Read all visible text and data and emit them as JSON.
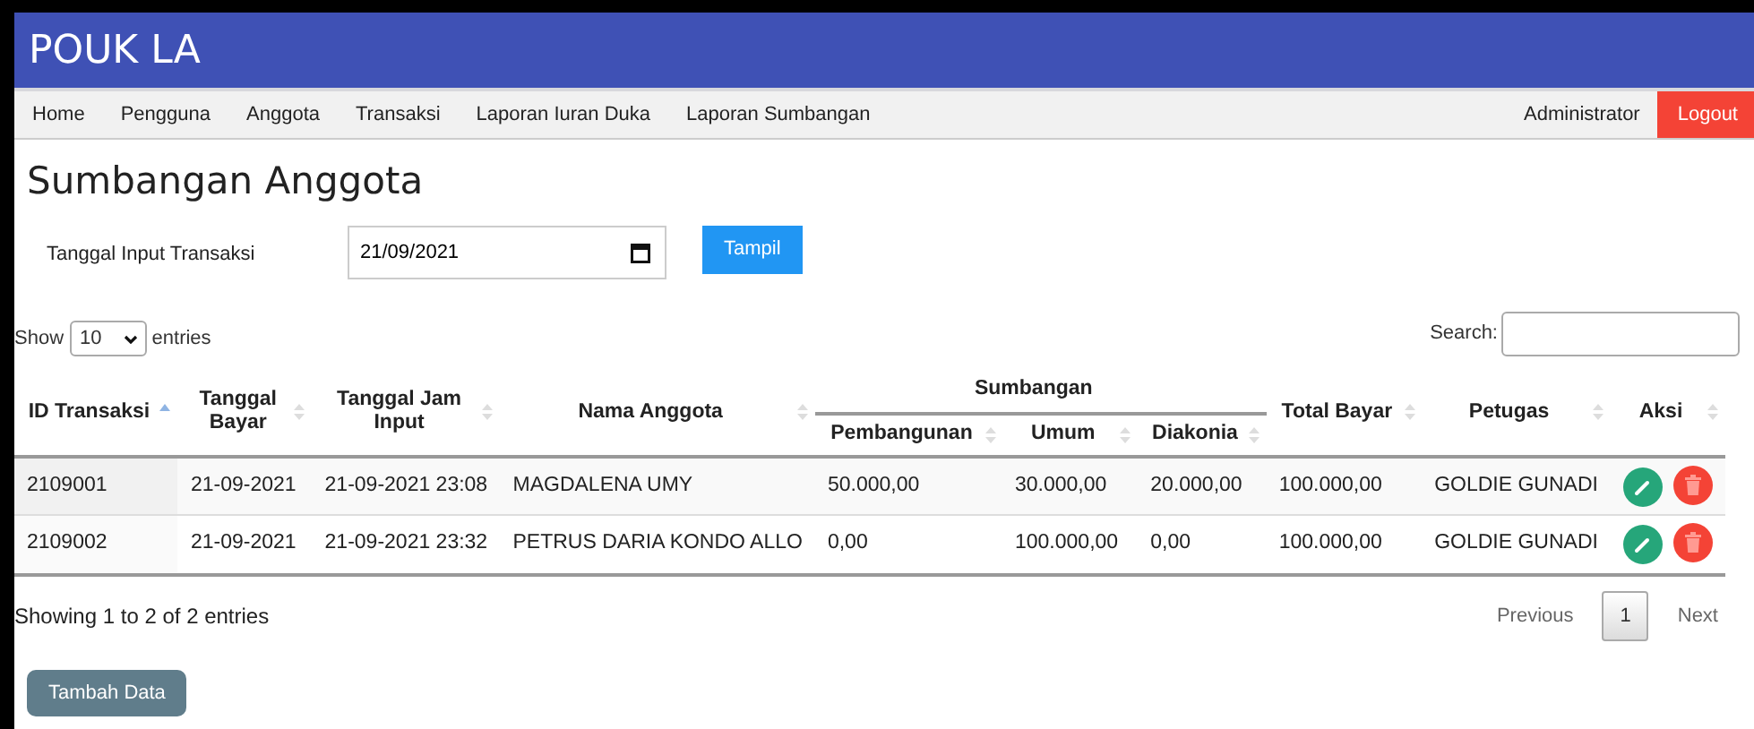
{
  "app_title": "POUK LA",
  "nav": {
    "items": [
      {
        "label": "Home"
      },
      {
        "label": "Pengguna"
      },
      {
        "label": "Anggota"
      },
      {
        "label": "Transaksi"
      },
      {
        "label": "Laporan Iuran Duka"
      },
      {
        "label": "Laporan Sumbangan"
      }
    ],
    "user": "Administrator",
    "logout": "Logout"
  },
  "page_title": "Sumbangan Anggota",
  "filter": {
    "label": "Tanggal Input Transaksi",
    "date_value": "21/09/2021",
    "button": "Tampil"
  },
  "table": {
    "length": {
      "prefix": "Show",
      "value": "10",
      "suffix": "entries"
    },
    "search_label": "Search:",
    "columns": [
      {
        "label": "ID Transaksi",
        "sorted": true
      },
      {
        "label": "Tanggal Bayar",
        "sorted": false
      },
      {
        "label": "Tanggal Jam Input",
        "sorted": false
      },
      {
        "label": "Nama Anggota",
        "sorted": false
      },
      {
        "label": "Sumbangan",
        "colspan": 3,
        "children": [
          {
            "label": "Pembangunan",
            "sorted": false
          },
          {
            "label": "Umum",
            "sorted": false
          },
          {
            "label": "Diakonia",
            "sorted": false
          }
        ]
      },
      {
        "label": "Total Bayar",
        "sorted": false
      },
      {
        "label": "Petugas",
        "sorted": false
      },
      {
        "label": "Aksi",
        "sorted": false
      }
    ],
    "rows": [
      {
        "cells": [
          "2109001",
          "21-09-2021",
          "21-09-2021 23:08",
          "MAGDALENA UMY",
          "50.000,00",
          "30.000,00",
          "20.000,00",
          "100.000,00",
          "GOLDIE GUNADI"
        ],
        "actions": [
          {
            "kind": "edit"
          },
          {
            "kind": "delete"
          }
        ]
      },
      {
        "cells": [
          "2109002",
          "21-09-2021",
          "21-09-2021 23:32",
          "PETRUS DARIA KONDO ALLO",
          "0,00",
          "100.000,00",
          "0,00",
          "100.000,00",
          "GOLDIE GUNADI"
        ],
        "actions": [
          {
            "kind": "edit"
          },
          {
            "kind": "delete"
          }
        ]
      }
    ],
    "info": "Showing 1 to 2 of 2 entries",
    "pagination": {
      "previous": "Previous",
      "pages": [
        {
          "label": "1",
          "selected": true
        }
      ],
      "next": "Next"
    }
  },
  "add_button": "Tambah Data"
}
